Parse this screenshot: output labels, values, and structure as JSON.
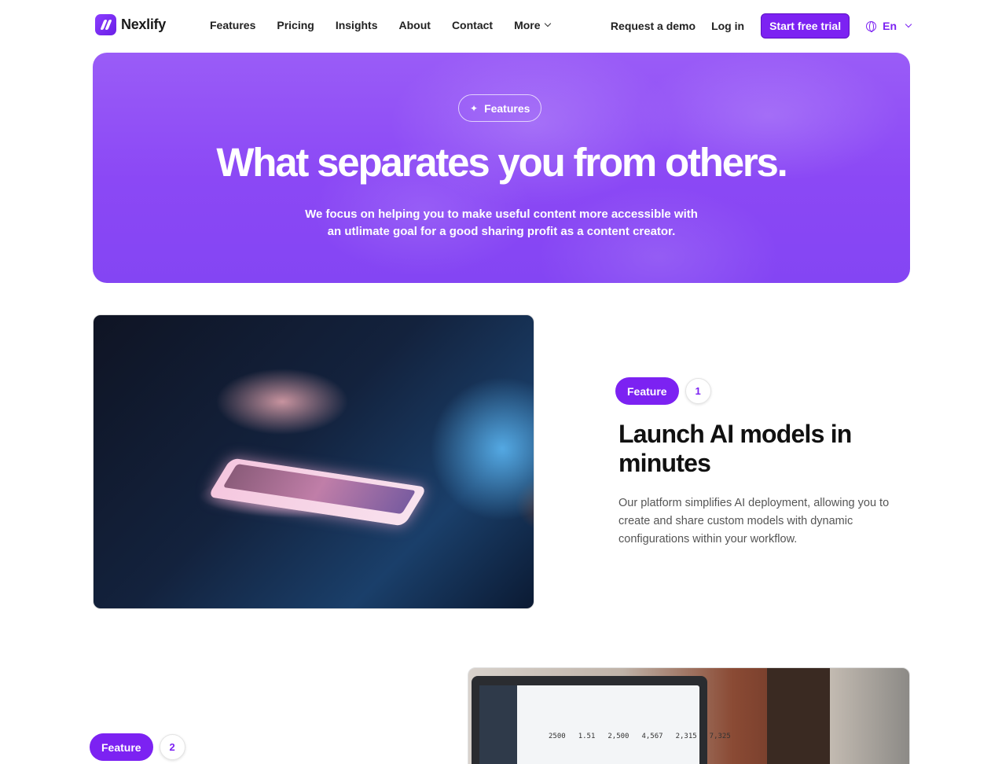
{
  "nav": {
    "brand": "Nexlify",
    "links": [
      "Features",
      "Pricing",
      "Insights",
      "About",
      "Contact",
      "More"
    ],
    "request_demo": "Request a demo",
    "login": "Log in",
    "trial": "Start free trial",
    "language": "En"
  },
  "hero": {
    "pill": "Features",
    "title": "What separates you from others.",
    "subtitle": "We focus on helping you to make useful content more accessible with an utlimate goal for a good sharing profit as a content creator."
  },
  "features": [
    {
      "badge": "Feature",
      "number": "1",
      "title": "Launch AI models in minutes",
      "text": "Our platform simplifies AI deployment, allowing you to create and share custom models with dynamic configurations within your workflow."
    },
    {
      "badge": "Feature",
      "number": "2",
      "screen_numbers": [
        "2500",
        "1.51",
        "2,500",
        "4,567",
        "2,315",
        "7,325"
      ]
    }
  ],
  "colors": {
    "accent": "#7c22f2",
    "hero_bg": "#8b48f5"
  }
}
